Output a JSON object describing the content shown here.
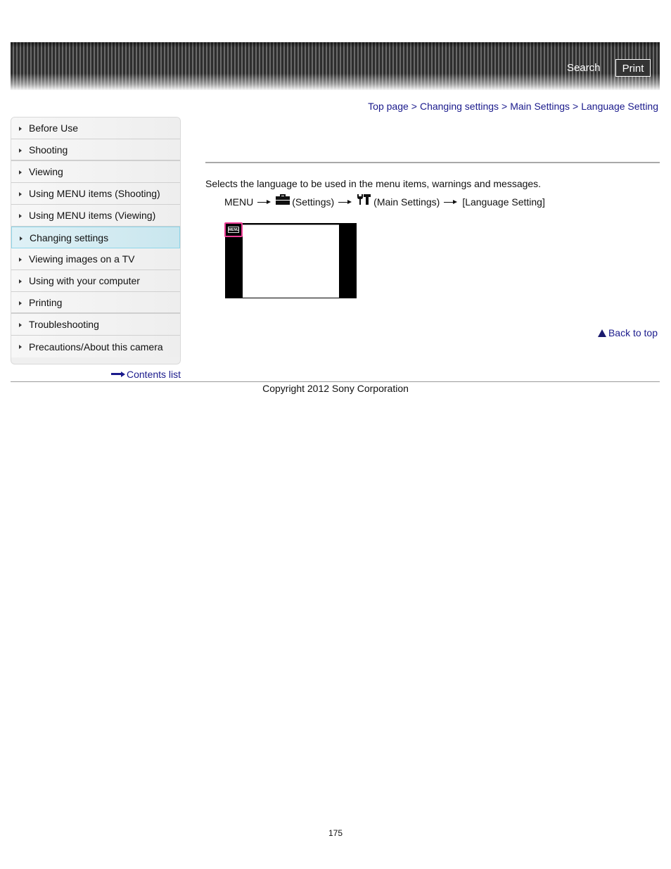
{
  "header": {
    "search_label": "Search",
    "print_label": "Print"
  },
  "breadcrumb": {
    "items": [
      "Top page",
      "Changing settings",
      "Main Settings",
      "Language Setting"
    ],
    "separator": ">"
  },
  "sidebar": {
    "items": [
      {
        "label": "Before Use"
      },
      {
        "label": "Shooting"
      },
      {
        "label": "Viewing"
      },
      {
        "label": "Using MENU items (Shooting)"
      },
      {
        "label": "Using MENU items (Viewing)"
      },
      {
        "label": "Changing settings",
        "active": true
      },
      {
        "label": "Viewing images on a TV"
      },
      {
        "label": "Using with your computer"
      },
      {
        "label": "Printing"
      },
      {
        "label": "Troubleshooting"
      },
      {
        "label": "Precautions/About this camera"
      }
    ],
    "contents_link": "Contents list"
  },
  "main": {
    "description": "Selects the language to be used in the menu items, warnings and messages.",
    "menu_path": {
      "step1": "MENU",
      "step2": "(Settings)",
      "step3": "(Main Settings)",
      "step4": "[Language Setting]"
    },
    "illustration": {
      "menu_chip_label": "MENU",
      "highlight_color": "#ee3d96"
    },
    "back_to_top": "Back to top"
  },
  "footer": {
    "copyright": "Copyright 2012 Sony Corporation",
    "page_number": "175"
  },
  "colors": {
    "link": "#1a1a8c",
    "active_item_border": "#8fd6ea"
  }
}
